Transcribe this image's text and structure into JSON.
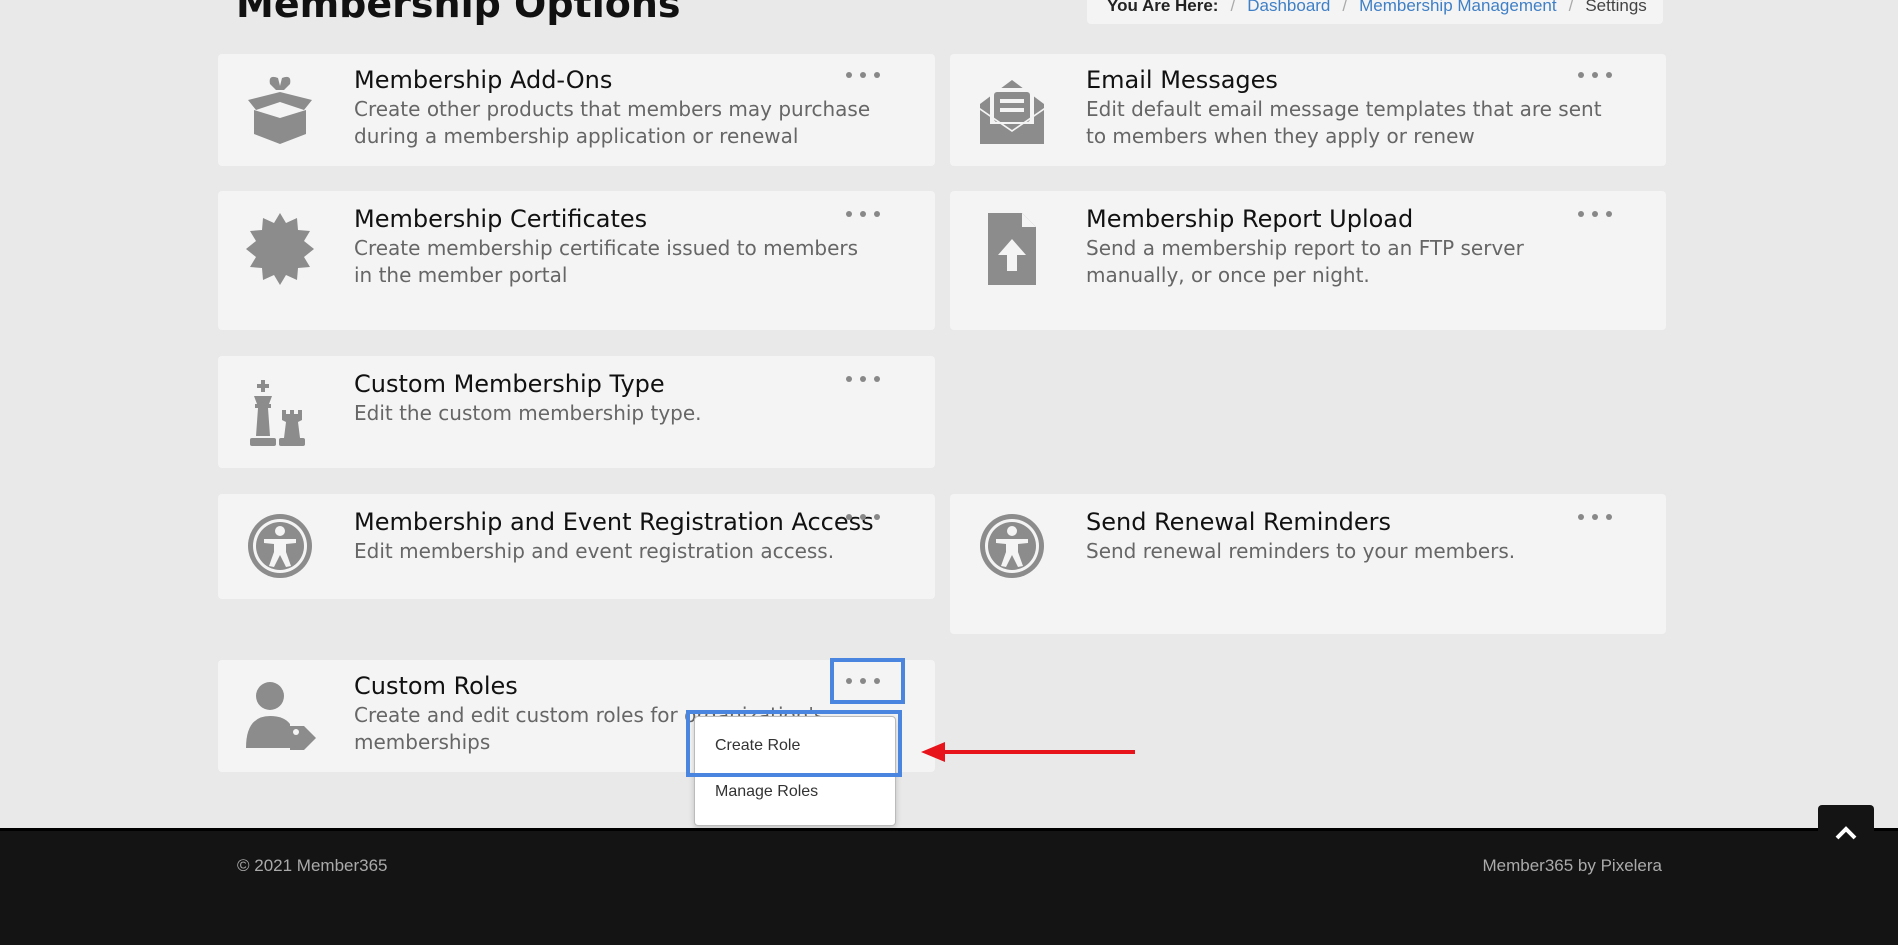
{
  "page": {
    "title": "Membership Options"
  },
  "breadcrumb": {
    "label": "You Are Here:",
    "items": [
      "Dashboard",
      "Membership Management"
    ],
    "current": "Settings"
  },
  "cards": [
    {
      "title": "Membership Add-Ons",
      "description": "Create other products that members may purchase during a membership application or renewal",
      "icon": "open-box-icon"
    },
    {
      "title": "Email Messages",
      "description": "Edit default email message templates that are sent to members when they apply or renew",
      "icon": "envelope-open-icon"
    },
    {
      "title": "Membership Certificates",
      "description": "Create membership certificate issued to members in the member portal",
      "icon": "certificate-icon"
    },
    {
      "title": "Membership Report Upload",
      "description": "Send a membership report to an FTP server manually, or once per night.",
      "icon": "file-upload-icon"
    },
    {
      "title": "Custom Membership Type",
      "description": "Edit the custom membership type.",
      "icon": "chess-icon"
    },
    {
      "title": "Membership and Event Registration Access",
      "description": "Edit membership and event registration access.",
      "icon": "accessibility-icon"
    },
    {
      "title": "Send Renewal Reminders",
      "description": "Send renewal reminders to your members.",
      "icon": "accessibility-icon"
    },
    {
      "title": "Custom Roles",
      "description": "Create and edit custom roles for organization's memberships",
      "icon": "user-tag-icon"
    }
  ],
  "dropdown": {
    "items": [
      "Create Role",
      "Manage Roles"
    ]
  },
  "footer": {
    "copyright": "© 2021 Member365",
    "credit": "Member365 by Pixelera"
  },
  "colors": {
    "highlight": "#4a86e0",
    "arrow": "#e8141b",
    "link": "#3f7fc6",
    "icon": "#8c8c8c"
  }
}
